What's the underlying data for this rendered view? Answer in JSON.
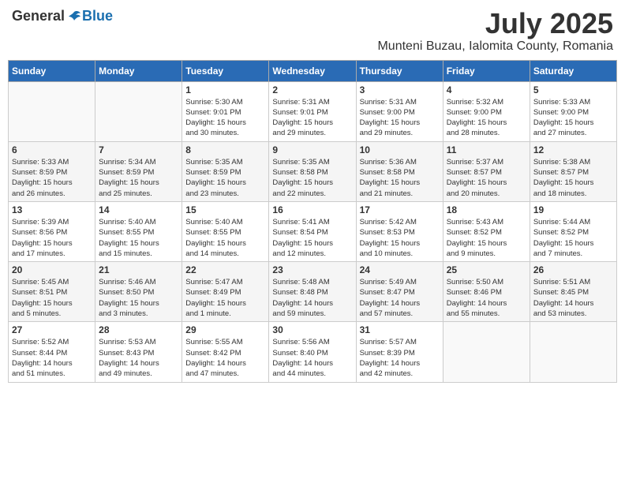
{
  "header": {
    "logo_general": "General",
    "logo_blue": "Blue",
    "month_title": "July 2025",
    "subtitle": "Munteni Buzau, Ialomita County, Romania"
  },
  "weekdays": [
    "Sunday",
    "Monday",
    "Tuesday",
    "Wednesday",
    "Thursday",
    "Friday",
    "Saturday"
  ],
  "weeks": [
    [
      {
        "day": "",
        "info": ""
      },
      {
        "day": "",
        "info": ""
      },
      {
        "day": "1",
        "info": "Sunrise: 5:30 AM\nSunset: 9:01 PM\nDaylight: 15 hours\nand 30 minutes."
      },
      {
        "day": "2",
        "info": "Sunrise: 5:31 AM\nSunset: 9:01 PM\nDaylight: 15 hours\nand 29 minutes."
      },
      {
        "day": "3",
        "info": "Sunrise: 5:31 AM\nSunset: 9:00 PM\nDaylight: 15 hours\nand 29 minutes."
      },
      {
        "day": "4",
        "info": "Sunrise: 5:32 AM\nSunset: 9:00 PM\nDaylight: 15 hours\nand 28 minutes."
      },
      {
        "day": "5",
        "info": "Sunrise: 5:33 AM\nSunset: 9:00 PM\nDaylight: 15 hours\nand 27 minutes."
      }
    ],
    [
      {
        "day": "6",
        "info": "Sunrise: 5:33 AM\nSunset: 8:59 PM\nDaylight: 15 hours\nand 26 minutes."
      },
      {
        "day": "7",
        "info": "Sunrise: 5:34 AM\nSunset: 8:59 PM\nDaylight: 15 hours\nand 25 minutes."
      },
      {
        "day": "8",
        "info": "Sunrise: 5:35 AM\nSunset: 8:59 PM\nDaylight: 15 hours\nand 23 minutes."
      },
      {
        "day": "9",
        "info": "Sunrise: 5:35 AM\nSunset: 8:58 PM\nDaylight: 15 hours\nand 22 minutes."
      },
      {
        "day": "10",
        "info": "Sunrise: 5:36 AM\nSunset: 8:58 PM\nDaylight: 15 hours\nand 21 minutes."
      },
      {
        "day": "11",
        "info": "Sunrise: 5:37 AM\nSunset: 8:57 PM\nDaylight: 15 hours\nand 20 minutes."
      },
      {
        "day": "12",
        "info": "Sunrise: 5:38 AM\nSunset: 8:57 PM\nDaylight: 15 hours\nand 18 minutes."
      }
    ],
    [
      {
        "day": "13",
        "info": "Sunrise: 5:39 AM\nSunset: 8:56 PM\nDaylight: 15 hours\nand 17 minutes."
      },
      {
        "day": "14",
        "info": "Sunrise: 5:40 AM\nSunset: 8:55 PM\nDaylight: 15 hours\nand 15 minutes."
      },
      {
        "day": "15",
        "info": "Sunrise: 5:40 AM\nSunset: 8:55 PM\nDaylight: 15 hours\nand 14 minutes."
      },
      {
        "day": "16",
        "info": "Sunrise: 5:41 AM\nSunset: 8:54 PM\nDaylight: 15 hours\nand 12 minutes."
      },
      {
        "day": "17",
        "info": "Sunrise: 5:42 AM\nSunset: 8:53 PM\nDaylight: 15 hours\nand 10 minutes."
      },
      {
        "day": "18",
        "info": "Sunrise: 5:43 AM\nSunset: 8:52 PM\nDaylight: 15 hours\nand 9 minutes."
      },
      {
        "day": "19",
        "info": "Sunrise: 5:44 AM\nSunset: 8:52 PM\nDaylight: 15 hours\nand 7 minutes."
      }
    ],
    [
      {
        "day": "20",
        "info": "Sunrise: 5:45 AM\nSunset: 8:51 PM\nDaylight: 15 hours\nand 5 minutes."
      },
      {
        "day": "21",
        "info": "Sunrise: 5:46 AM\nSunset: 8:50 PM\nDaylight: 15 hours\nand 3 minutes."
      },
      {
        "day": "22",
        "info": "Sunrise: 5:47 AM\nSunset: 8:49 PM\nDaylight: 15 hours\nand 1 minute."
      },
      {
        "day": "23",
        "info": "Sunrise: 5:48 AM\nSunset: 8:48 PM\nDaylight: 14 hours\nand 59 minutes."
      },
      {
        "day": "24",
        "info": "Sunrise: 5:49 AM\nSunset: 8:47 PM\nDaylight: 14 hours\nand 57 minutes."
      },
      {
        "day": "25",
        "info": "Sunrise: 5:50 AM\nSunset: 8:46 PM\nDaylight: 14 hours\nand 55 minutes."
      },
      {
        "day": "26",
        "info": "Sunrise: 5:51 AM\nSunset: 8:45 PM\nDaylight: 14 hours\nand 53 minutes."
      }
    ],
    [
      {
        "day": "27",
        "info": "Sunrise: 5:52 AM\nSunset: 8:44 PM\nDaylight: 14 hours\nand 51 minutes."
      },
      {
        "day": "28",
        "info": "Sunrise: 5:53 AM\nSunset: 8:43 PM\nDaylight: 14 hours\nand 49 minutes."
      },
      {
        "day": "29",
        "info": "Sunrise: 5:55 AM\nSunset: 8:42 PM\nDaylight: 14 hours\nand 47 minutes."
      },
      {
        "day": "30",
        "info": "Sunrise: 5:56 AM\nSunset: 8:40 PM\nDaylight: 14 hours\nand 44 minutes."
      },
      {
        "day": "31",
        "info": "Sunrise: 5:57 AM\nSunset: 8:39 PM\nDaylight: 14 hours\nand 42 minutes."
      },
      {
        "day": "",
        "info": ""
      },
      {
        "day": "",
        "info": ""
      }
    ]
  ]
}
